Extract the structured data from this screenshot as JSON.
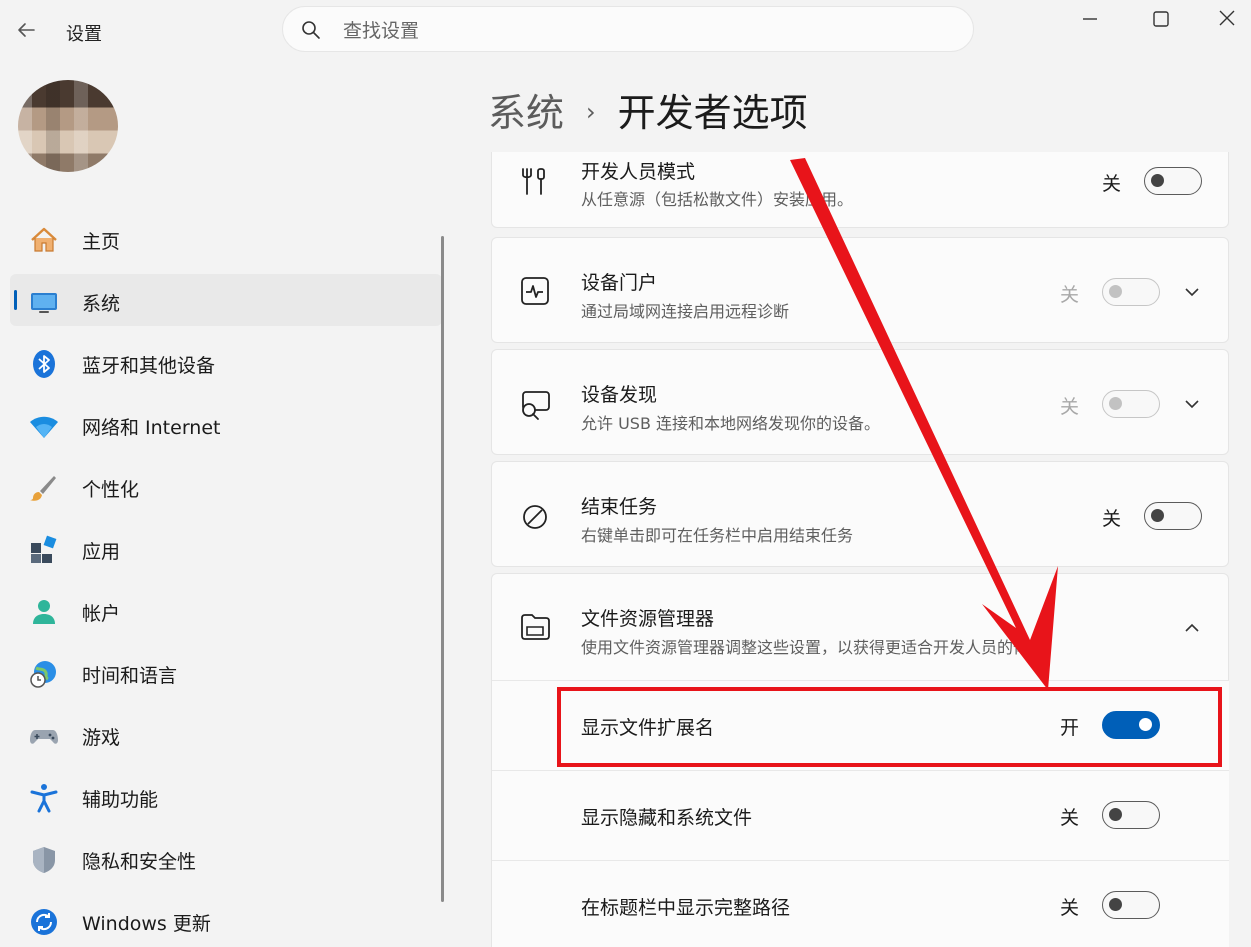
{
  "window": {
    "title": "设置",
    "search_placeholder": "查找设置"
  },
  "sidebar": {
    "items": [
      {
        "label": "主页",
        "icon": "home-icon",
        "active": false
      },
      {
        "label": "系统",
        "icon": "system-icon",
        "active": true
      },
      {
        "label": "蓝牙和其他设备",
        "icon": "bluetooth-icon",
        "active": false
      },
      {
        "label": "网络和 Internet",
        "icon": "wifi-icon",
        "active": false
      },
      {
        "label": "个性化",
        "icon": "brush-icon",
        "active": false
      },
      {
        "label": "应用",
        "icon": "apps-icon",
        "active": false
      },
      {
        "label": "帐户",
        "icon": "account-icon",
        "active": false
      },
      {
        "label": "时间和语言",
        "icon": "globe-clock-icon",
        "active": false
      },
      {
        "label": "游戏",
        "icon": "gamepad-icon",
        "active": false
      },
      {
        "label": "辅助功能",
        "icon": "accessibility-icon",
        "active": false
      },
      {
        "label": "隐私和安全性",
        "icon": "shield-icon",
        "active": false
      },
      {
        "label": "Windows 更新",
        "icon": "update-icon",
        "active": false
      }
    ]
  },
  "breadcrumb": {
    "parent": "系统",
    "separator": "›",
    "current": "开发者选项"
  },
  "settings": {
    "developer_mode": {
      "title": "开发人员模式",
      "desc": "从任意源（包括松散文件）安装应用。",
      "state": "关",
      "on": false,
      "icon": "developer-tools-icon"
    },
    "device_portal": {
      "title": "设备门户",
      "desc": "通过局域网连接启用远程诊断",
      "state": "关",
      "on": false,
      "enabled": false,
      "icon": "pulse-icon"
    },
    "device_discovery": {
      "title": "设备发现",
      "desc": "允许 USB 连接和本地网络发现你的设备。",
      "state": "关",
      "on": false,
      "enabled": false,
      "icon": "device-discovery-icon"
    },
    "end_task": {
      "title": "结束任务",
      "desc": "右键单击即可在任务栏中启用结束任务",
      "state": "关",
      "on": false,
      "icon": "prohibited-icon"
    },
    "file_explorer": {
      "title": "文件资源管理器",
      "desc": "使用文件资源管理器调整这些设置，以获得更适合开发人员的体验",
      "icon": "folder-icon",
      "expanded": true,
      "options": [
        {
          "label": "显示文件扩展名",
          "state": "开",
          "on": true
        },
        {
          "label": "显示隐藏和系统文件",
          "state": "关",
          "on": false
        },
        {
          "label": "在标题栏中显示完整路径",
          "state": "关",
          "on": false
        }
      ]
    }
  },
  "annotation": {
    "highlight_color": "#e8141a",
    "arrow_color": "#e8141a"
  },
  "colors": {
    "accent": "#005fb8",
    "background": "#f3f3f3",
    "card": "#fbfbfb"
  }
}
